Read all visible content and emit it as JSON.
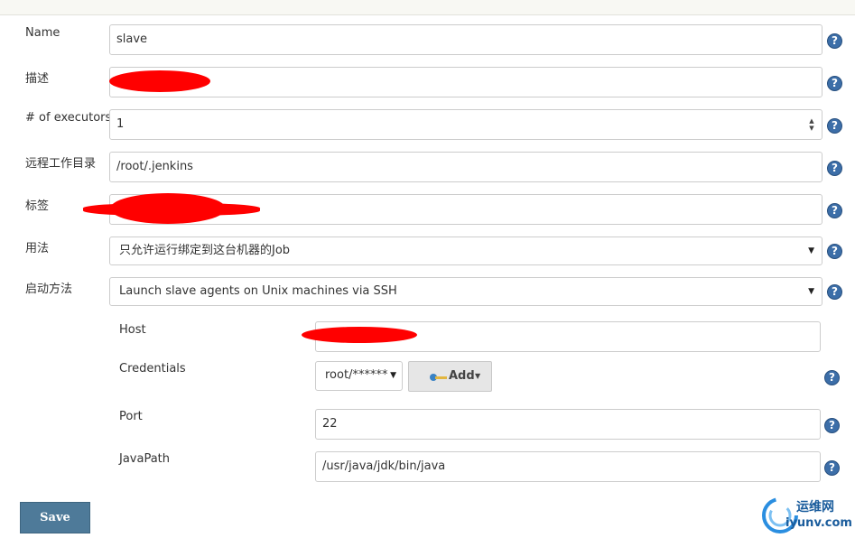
{
  "form": {
    "name": {
      "label": "Name",
      "value": "slave"
    },
    "description": {
      "label": "描述",
      "value": ""
    },
    "executors": {
      "label": "# of executors",
      "value": "1"
    },
    "remote_root": {
      "label": "远程工作目录",
      "value": "/root/.jenkins"
    },
    "labels": {
      "label": "标签",
      "value": ""
    },
    "usage": {
      "label": "用法",
      "value": "只允许运行绑定到这台机器的Job"
    },
    "launch_method": {
      "label": "启动方法",
      "value": "Launch slave agents on Unix machines via SSH"
    }
  },
  "ssh": {
    "host": {
      "label": "Host",
      "value": ""
    },
    "credentials": {
      "label": "Credentials",
      "value": "root/******",
      "add_label": "Add"
    },
    "port": {
      "label": "Port",
      "value": "22"
    },
    "javapath": {
      "label": "JavaPath",
      "value": "/usr/java/jdk/bin/java"
    }
  },
  "help_symbol": "?",
  "save_label": "Save",
  "watermark": {
    "cn": "运维网",
    "url": "iyunv.com"
  },
  "colors": {
    "help": "#3c6ea8",
    "save": "#4e7a99",
    "redaction": "#ff0000"
  },
  "icons": [
    "help-icon",
    "key-icon",
    "chevron-down-icon",
    "spinner-icon"
  ]
}
